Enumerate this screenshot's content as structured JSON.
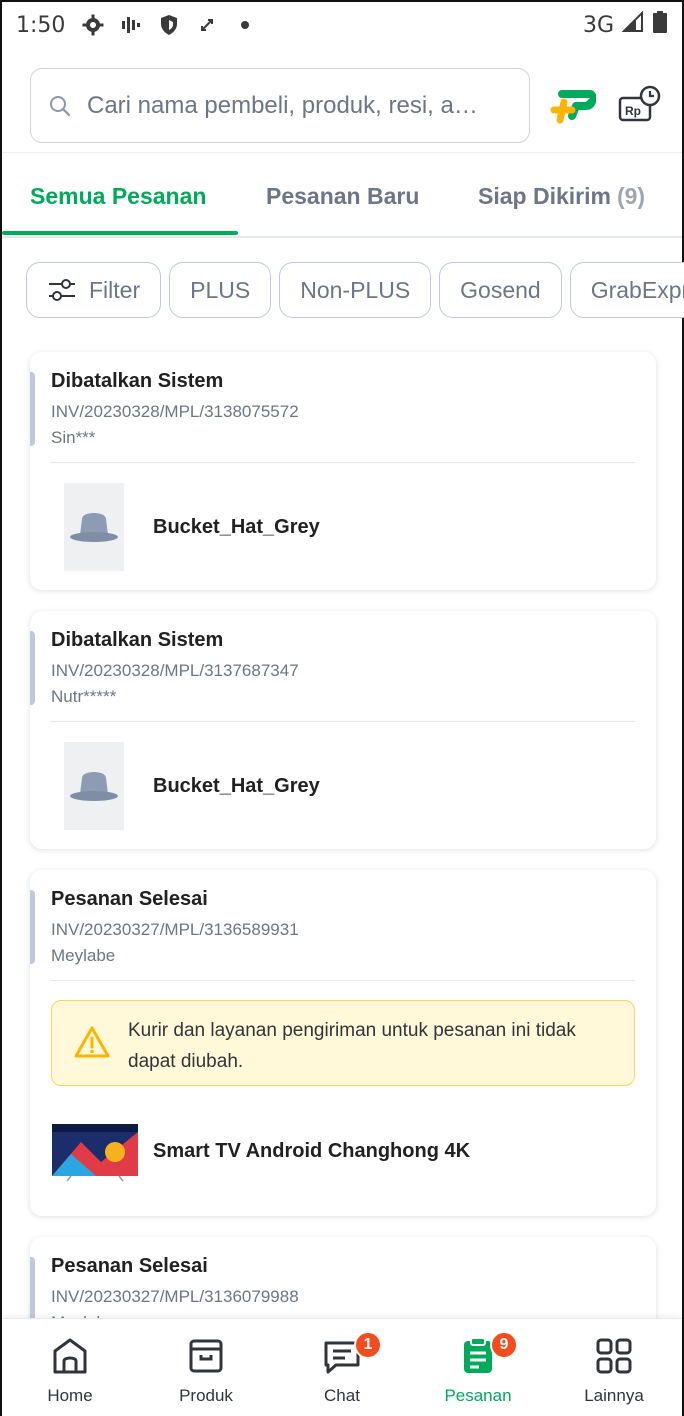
{
  "status_bar": {
    "time": "1:50",
    "network": "3G"
  },
  "search": {
    "placeholder": "Cari nama pembeli, produk, resi, a…"
  },
  "tabs": [
    {
      "label": "Semua Pesanan"
    },
    {
      "label": "Pesanan Baru"
    },
    {
      "label": "Siap Dikirim",
      "count": "(9)"
    }
  ],
  "chips": [
    {
      "label": "Filter",
      "icon": "sliders-icon"
    },
    {
      "label": "PLUS"
    },
    {
      "label": "Non-PLUS"
    },
    {
      "label": "Gosend"
    },
    {
      "label": "GrabExpr"
    }
  ],
  "orders": [
    {
      "status": "Dibatalkan Sistem",
      "invoice": "INV/20230328/MPL/3138075572",
      "buyer": "Sin***",
      "product": "Bucket_Hat_Grey"
    },
    {
      "status": "Dibatalkan Sistem",
      "invoice": "INV/20230328/MPL/3137687347",
      "buyer": "Nutr*****",
      "product": "Bucket_Hat_Grey"
    },
    {
      "status": "Pesanan Selesai",
      "invoice": "INV/20230327/MPL/3136589931",
      "buyer": "Meylabe",
      "notice": "Kurir dan layanan pengiriman untuk pesanan ini tidak dapat diubah.",
      "product": "Smart TV Android Changhong 4K"
    },
    {
      "status": "Pesanan Selesai",
      "invoice": "INV/20230327/MPL/3136079988",
      "buyer": "Meylabe"
    }
  ],
  "bottom_nav": [
    {
      "label": "Home",
      "icon": "store-icon"
    },
    {
      "label": "Produk",
      "icon": "box-icon"
    },
    {
      "label": "Chat",
      "icon": "chat-icon",
      "badge": "1"
    },
    {
      "label": "Pesanan",
      "icon": "order-list-icon",
      "badge": "9",
      "active": true
    },
    {
      "label": "Lainnya",
      "icon": "grid-icon"
    }
  ],
  "colors": {
    "accent": "#00aa5b",
    "badge": "#f54b1e",
    "notice_bg": "#fff8d9",
    "notice_border": "#ffd45f"
  }
}
